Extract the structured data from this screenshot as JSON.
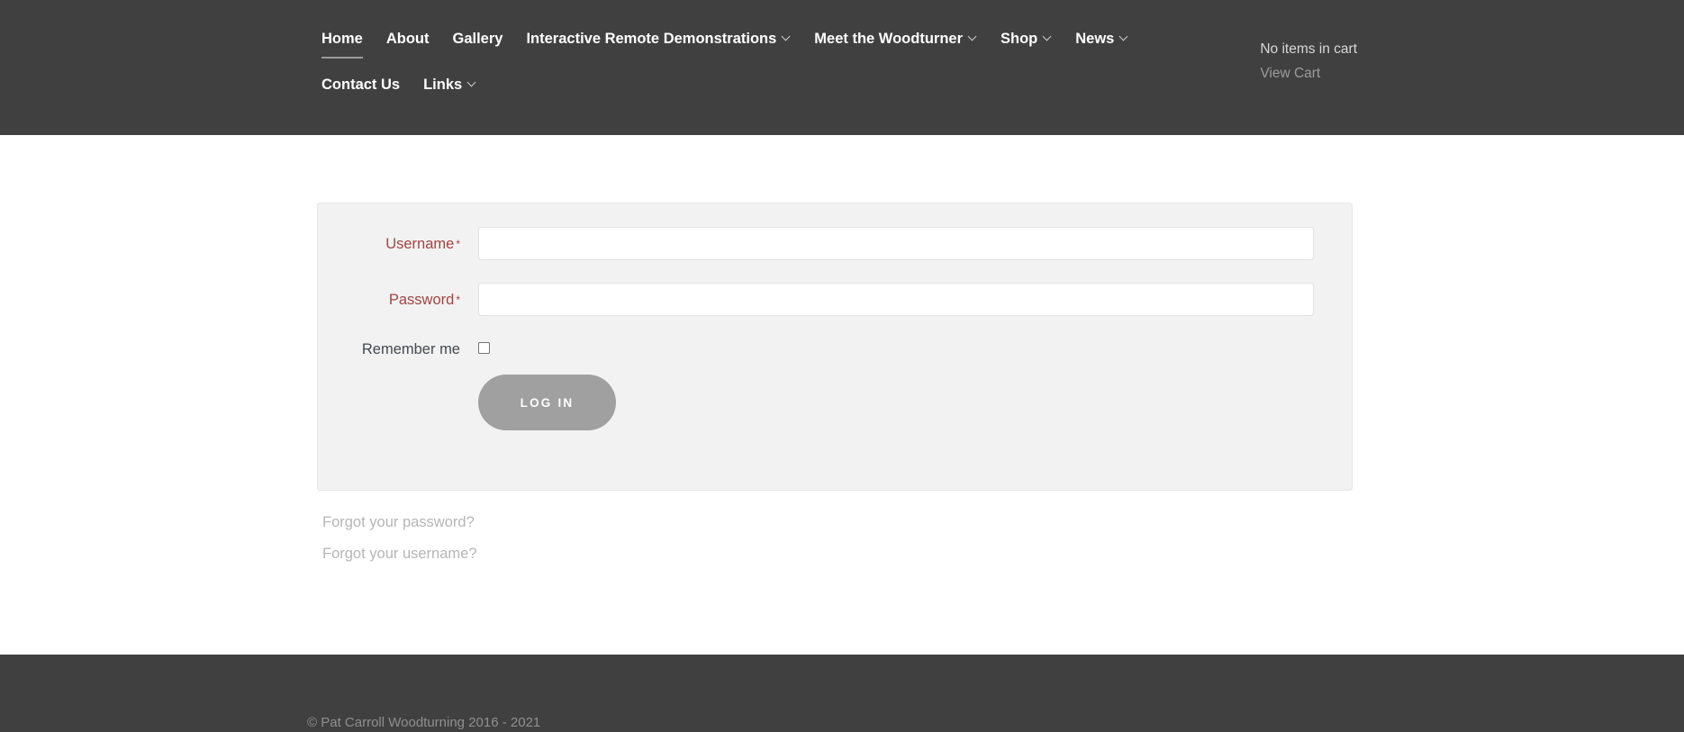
{
  "header": {
    "background": "#404040",
    "nav": {
      "items": [
        {
          "label": "Home",
          "has_dropdown": false,
          "active": true
        },
        {
          "label": "About",
          "has_dropdown": false,
          "active": false
        },
        {
          "label": "Gallery",
          "has_dropdown": false,
          "active": false
        },
        {
          "label": "Interactive Remote Demonstrations",
          "has_dropdown": true,
          "active": false
        },
        {
          "label": "Meet the Woodturner",
          "has_dropdown": true,
          "active": false
        },
        {
          "label": "Shop",
          "has_dropdown": true,
          "active": false
        },
        {
          "label": "News",
          "has_dropdown": true,
          "active": false
        },
        {
          "label": "Contact Us",
          "has_dropdown": false,
          "active": false
        },
        {
          "label": "Links",
          "has_dropdown": true,
          "active": false
        }
      ]
    },
    "cart": {
      "status": "No items in cart",
      "view_cart_label": "View Cart"
    }
  },
  "login_form": {
    "username": {
      "label": "Username",
      "required_marker": "*",
      "value": "",
      "placeholder": ""
    },
    "password": {
      "label": "Password",
      "required_marker": "*",
      "value": "",
      "placeholder": ""
    },
    "remember": {
      "label": "Remember me",
      "checked": false
    },
    "submit_label": "Log in",
    "panel_background": "#f2f2f2",
    "label_color": "#a34444",
    "button_color": "#a0a0a0"
  },
  "helper_links": [
    {
      "label": "Forgot your password?"
    },
    {
      "label": "Forgot your username?"
    }
  ],
  "footer": {
    "copyright": "© Pat Carroll Woodturning 2016 - 2021"
  }
}
